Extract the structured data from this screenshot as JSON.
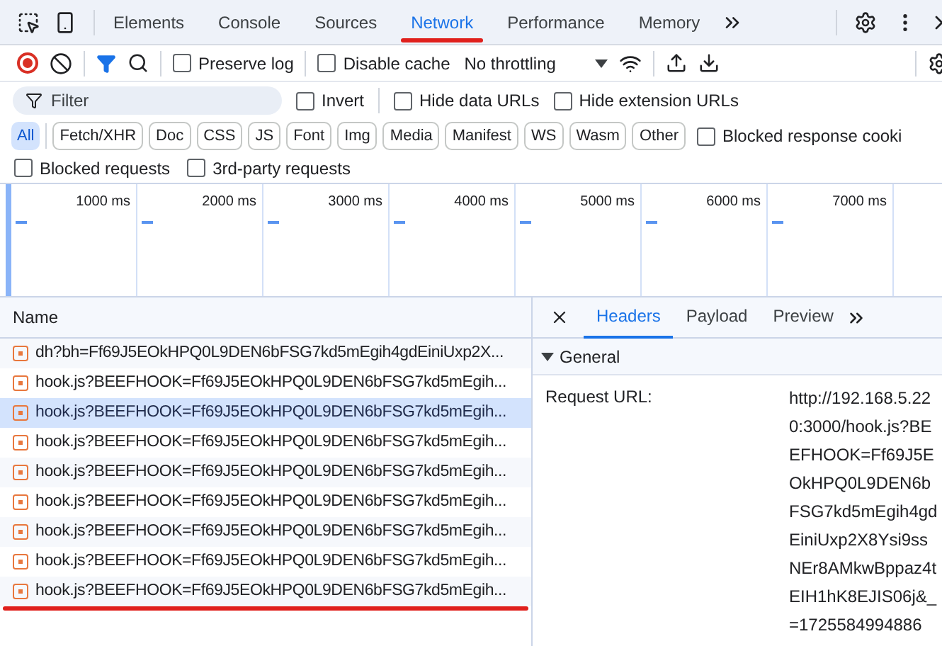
{
  "tabs": [
    {
      "label": "Elements",
      "selected": false
    },
    {
      "label": "Console",
      "selected": false
    },
    {
      "label": "Sources",
      "selected": false
    },
    {
      "label": "Network",
      "selected": true
    },
    {
      "label": "Performance",
      "selected": false
    },
    {
      "label": "Memory",
      "selected": false
    }
  ],
  "toolbar": {
    "recording": true,
    "preserve_log": {
      "label": "Preserve log",
      "checked": false
    },
    "disable_cache": {
      "label": "Disable cache",
      "checked": false
    },
    "throttling": "No throttling"
  },
  "filter": {
    "placeholder": "Filter",
    "options": [
      {
        "label": "Invert",
        "checked": false
      },
      {
        "label": "Hide data URLs",
        "checked": false
      },
      {
        "label": "Hide extension URLs",
        "checked": false
      }
    ]
  },
  "type_filters": [
    {
      "label": "All",
      "selected": true
    },
    {
      "label": "Fetch/XHR",
      "selected": false
    },
    {
      "label": "Doc",
      "selected": false
    },
    {
      "label": "CSS",
      "selected": false
    },
    {
      "label": "JS",
      "selected": false
    },
    {
      "label": "Font",
      "selected": false
    },
    {
      "label": "Img",
      "selected": false
    },
    {
      "label": "Media",
      "selected": false
    },
    {
      "label": "Manifest",
      "selected": false
    },
    {
      "label": "WS",
      "selected": false
    },
    {
      "label": "Wasm",
      "selected": false
    },
    {
      "label": "Other",
      "selected": false
    }
  ],
  "more_options": [
    {
      "label": "Blocked response cooki",
      "checked": false
    },
    {
      "label": "Blocked requests",
      "checked": false
    },
    {
      "label": "3rd-party requests",
      "checked": false
    }
  ],
  "timeline": {
    "ticks": [
      "1000 ms",
      "2000 ms",
      "3000 ms",
      "4000 ms",
      "5000 ms",
      "6000 ms",
      "7000 ms"
    ]
  },
  "requests": {
    "column": "Name",
    "rows": [
      {
        "name": "dh?bh=Ff69J5EOkHPQ0L9DEN6bFSG7kd5mEgih4gdEiniUxp2X...",
        "selected": false
      },
      {
        "name": "hook.js?BEEFHOOK=Ff69J5EOkHPQ0L9DEN6bFSG7kd5mEgih...",
        "selected": false
      },
      {
        "name": "hook.js?BEEFHOOK=Ff69J5EOkHPQ0L9DEN6bFSG7kd5mEgih...",
        "selected": true
      },
      {
        "name": "hook.js?BEEFHOOK=Ff69J5EOkHPQ0L9DEN6bFSG7kd5mEgih...",
        "selected": false
      },
      {
        "name": "hook.js?BEEFHOOK=Ff69J5EOkHPQ0L9DEN6bFSG7kd5mEgih...",
        "selected": false
      },
      {
        "name": "hook.js?BEEFHOOK=Ff69J5EOkHPQ0L9DEN6bFSG7kd5mEgih...",
        "selected": false
      },
      {
        "name": "hook.js?BEEFHOOK=Ff69J5EOkHPQ0L9DEN6bFSG7kd5mEgih...",
        "selected": false
      },
      {
        "name": "hook.js?BEEFHOOK=Ff69J5EOkHPQ0L9DEN6bFSG7kd5mEgih...",
        "selected": false
      },
      {
        "name": "hook.js?BEEFHOOK=Ff69J5EOkHPQ0L9DEN6bFSG7kd5mEgih...",
        "selected": false
      }
    ]
  },
  "details": {
    "tabs": [
      {
        "label": "Headers",
        "selected": true
      },
      {
        "label": "Payload",
        "selected": false
      },
      {
        "label": "Preview",
        "selected": false
      }
    ],
    "section": {
      "title": "General",
      "expanded": true
    },
    "fields": [
      {
        "label": "Request URL:",
        "value": "http://192.168.5.220:3000/hook.js?BEEFHOOK=Ff69J5EOkHPQ0L9DEN6bFSG7kd5mEgih4gdEiniUxp2X8Ysi9ssNEr8AMkwBppaz4tEIH1hK8EJIS06j&_=1725584994886"
      }
    ]
  }
}
